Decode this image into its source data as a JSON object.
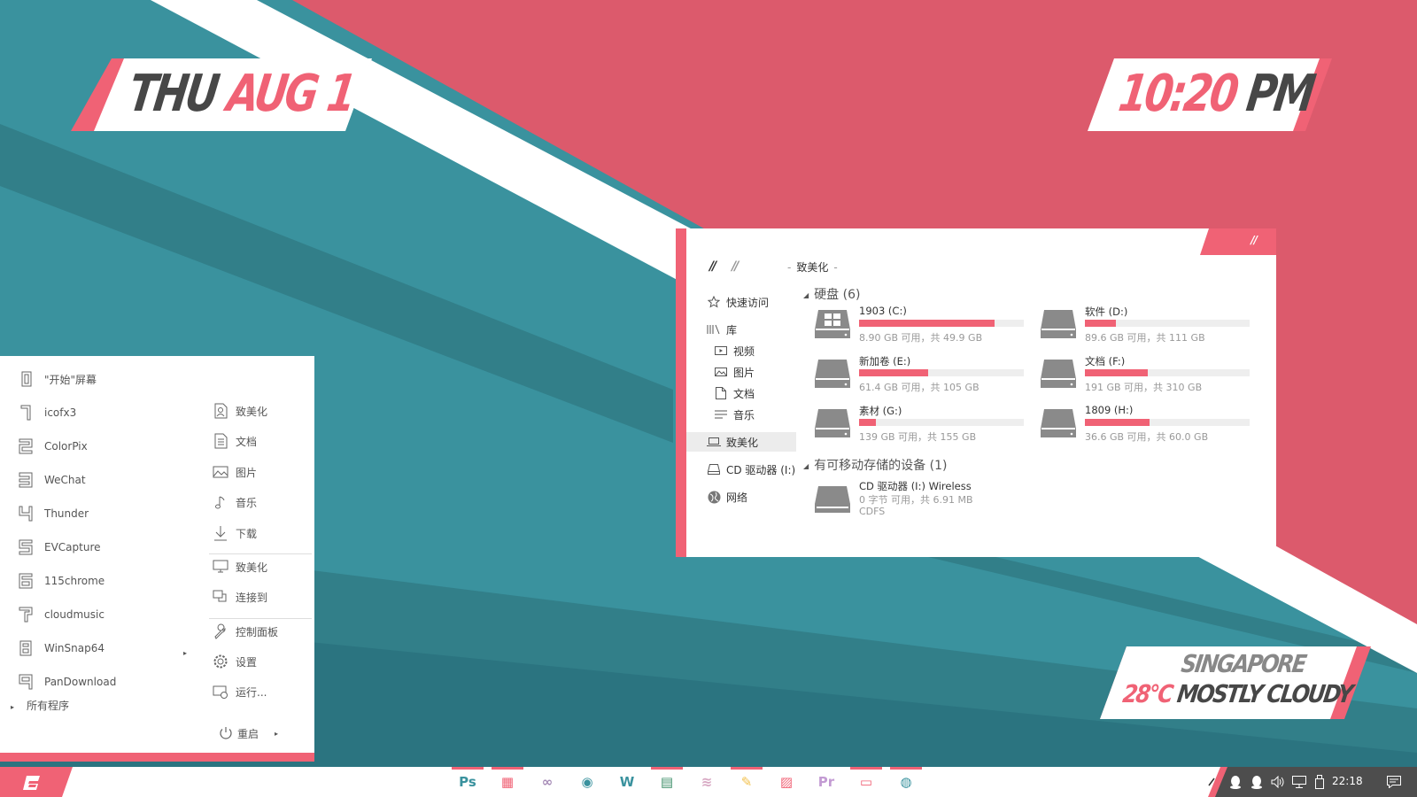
{
  "colors": {
    "teal": "#3a929e",
    "teal_dark": "#327f89",
    "teal_darker": "#2b7480",
    "pink": "#dc5a6c",
    "accent": "#f06275",
    "white": "#ffffff",
    "dark_text": "#474747",
    "taskbar_dark": "#4d4d4d"
  },
  "widgets": {
    "date": {
      "day": "THU",
      "month_day": "AUG 1"
    },
    "time": {
      "hm": "10:20",
      "ampm": "PM"
    },
    "weather": {
      "city": "SINGAPORE",
      "temp": "28°C",
      "condition": "MOSTLY CLOUDY"
    }
  },
  "explorer": {
    "back_label": "//",
    "forward_label": "//",
    "corner_label": "//",
    "address": "致美化",
    "sidebar": {
      "quick_access": "快速访问",
      "library": "库",
      "videos": "视频",
      "pictures": "图片",
      "documents": "文档",
      "music": "音乐",
      "this_pc": "致美化",
      "cd_drive": "CD 驱动器 (I:)",
      "network": "网络"
    },
    "hard_disks": {
      "header": "硬盘 (6)",
      "drives": [
        {
          "name": "1903 (C:)",
          "size": "8.90 GB 可用，共 49.9 GB",
          "used_fraction": 0.82,
          "icon": "windows-drive-icon"
        },
        {
          "name": "软件 (D:)",
          "size": "89.6 GB 可用，共 111 GB",
          "used_fraction": 0.19,
          "icon": "hard-drive-icon"
        },
        {
          "name": "新加卷 (E:)",
          "size": "61.4 GB 可用，共 105 GB",
          "used_fraction": 0.42,
          "icon": "hard-drive-icon"
        },
        {
          "name": "文档 (F:)",
          "size": "191 GB 可用，共 310 GB",
          "used_fraction": 0.38,
          "icon": "hard-drive-icon"
        },
        {
          "name": "素材 (G:)",
          "size": "139 GB 可用，共 155 GB",
          "used_fraction": 0.1,
          "icon": "hard-drive-icon"
        },
        {
          "name": "1809 (H:)",
          "size": "36.6 GB 可用，共 60.0 GB",
          "used_fraction": 0.39,
          "icon": "hard-drive-icon"
        }
      ]
    },
    "removable": {
      "header": "有可移动存储的设备 (1)",
      "device": {
        "name": "CD 驱动器 (I:) Wireless",
        "size": "0 字节 可用，共 6.91 MB",
        "fs": "CDFS"
      }
    }
  },
  "start_menu": {
    "apps": [
      {
        "label": "\"开始\"屏幕",
        "badge": "0"
      },
      {
        "label": "icofx3",
        "badge": "1"
      },
      {
        "label": "ColorPix",
        "badge": "2"
      },
      {
        "label": "WeChat",
        "badge": "3"
      },
      {
        "label": "Thunder",
        "badge": "4"
      },
      {
        "label": "EVCapture",
        "badge": "5"
      },
      {
        "label": "115chrome",
        "badge": "6"
      },
      {
        "label": "cloudmusic",
        "badge": "7"
      },
      {
        "label": "WinSnap64",
        "badge": "8"
      },
      {
        "label": "PanDownload",
        "badge": "9"
      }
    ],
    "all_programs": "所有程序",
    "places": [
      {
        "label": "致美化",
        "icon": "user-folder-icon"
      },
      {
        "label": "文档",
        "icon": "document-icon"
      },
      {
        "label": "图片",
        "icon": "picture-icon"
      },
      {
        "label": "音乐",
        "icon": "music-icon"
      },
      {
        "label": "下载",
        "icon": "download-icon"
      }
    ],
    "system": [
      {
        "label": "致美化",
        "icon": "computer-icon"
      },
      {
        "label": "连接到",
        "icon": "connect-icon"
      }
    ],
    "tools": [
      {
        "label": "控制面板",
        "icon": "wrench-icon"
      },
      {
        "label": "设置",
        "icon": "gear-icon"
      },
      {
        "label": "运行...",
        "icon": "run-icon"
      }
    ],
    "restart": "重启"
  },
  "taskbar": {
    "pinned": [
      {
        "name": "photoshop",
        "glyph": "Ps",
        "color": "#3a929e",
        "active": true
      },
      {
        "name": "grid-app",
        "glyph": "▦",
        "color": "#f06275",
        "active": true
      },
      {
        "name": "link-app",
        "glyph": "∞",
        "color": "#a58ab6",
        "active": false
      },
      {
        "name": "camera-app",
        "glyph": "◉",
        "color": "#3a929e",
        "active": false
      },
      {
        "name": "word",
        "glyph": "W",
        "color": "#3a929e",
        "active": false
      },
      {
        "name": "sheet-app",
        "glyph": "▤",
        "color": "#3f8f6a",
        "active": true
      },
      {
        "name": "ruler-app",
        "glyph": "≋",
        "color": "#d7a7c2",
        "active": false
      },
      {
        "name": "pen-app",
        "glyph": "✎",
        "color": "#f2c14e",
        "active": true
      },
      {
        "name": "paint-app",
        "glyph": "▨",
        "color": "#f06275",
        "active": false
      },
      {
        "name": "premiere",
        "glyph": "Pr",
        "color": "#c39bd3",
        "active": false
      },
      {
        "name": "monitor-app",
        "glyph": "▭",
        "color": "#f06275",
        "active": true
      },
      {
        "name": "globe-app",
        "glyph": "◍",
        "color": "#3a929e",
        "active": true
      }
    ],
    "clock": "22:18"
  }
}
